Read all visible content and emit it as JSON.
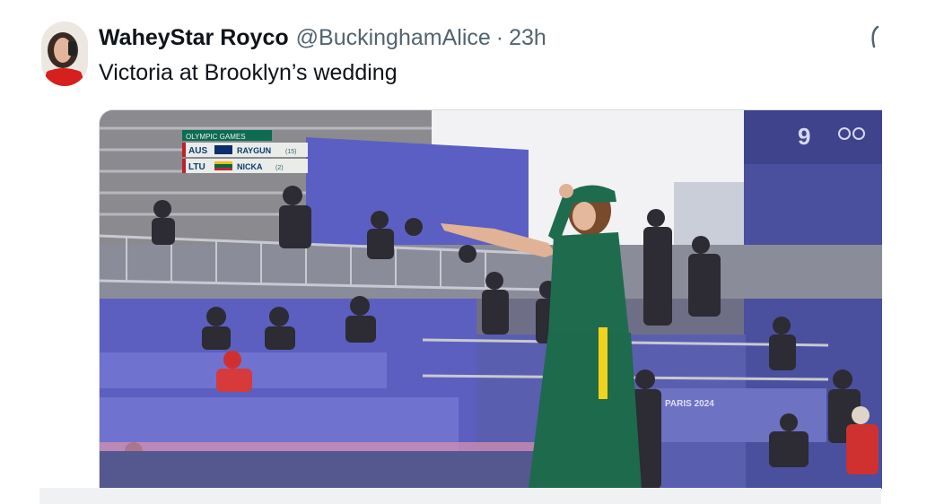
{
  "tweet": {
    "display_name": "WaheyStar Royco",
    "handle": "@BuckinghamAlice",
    "separator": "·",
    "time": "23h",
    "text": "Victoria at Brooklyn’s wedding"
  },
  "video": {
    "scoreboard": {
      "header": "OLYMPIC GAMES",
      "rows": [
        {
          "country": "AUS",
          "athlete": "RAYGUN",
          "seed": "(15)"
        },
        {
          "country": "LTU",
          "athlete": "NICKA",
          "seed": "(2)"
        }
      ]
    },
    "broadcaster_logo": "9",
    "banner_text": "PARIS 2024",
    "colors": {
      "stage_blue": "#5a5fbf",
      "athlete_green": "#1f6b4e",
      "athlete_yellow": "#f2d21b",
      "scoreboard_bg": "#0d6b52"
    }
  },
  "icons": {
    "more": "more-icon"
  }
}
